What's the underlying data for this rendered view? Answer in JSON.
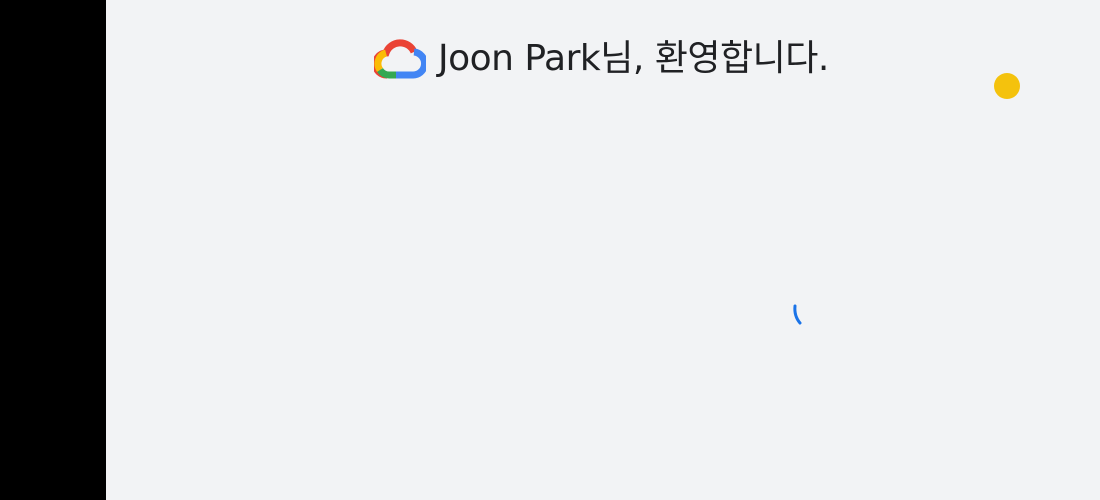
{
  "header": {
    "logo_icon": "google-cloud-logo-icon",
    "welcome_text": "Joon Park님, 환영합니다."
  },
  "loading": {
    "icon": "loading-spinner-icon"
  },
  "decoration": {
    "dot_icon": "yellow-dot-icon"
  },
  "colors": {
    "background": "#f2f3f5",
    "side_bar": "#000000",
    "text": "#202124",
    "google_blue": "#4285f4",
    "google_red": "#ea4335",
    "google_yellow": "#fbbc05",
    "google_green": "#34a853",
    "dot_yellow": "#f4c20d",
    "spinner_blue": "#1a73e8"
  }
}
